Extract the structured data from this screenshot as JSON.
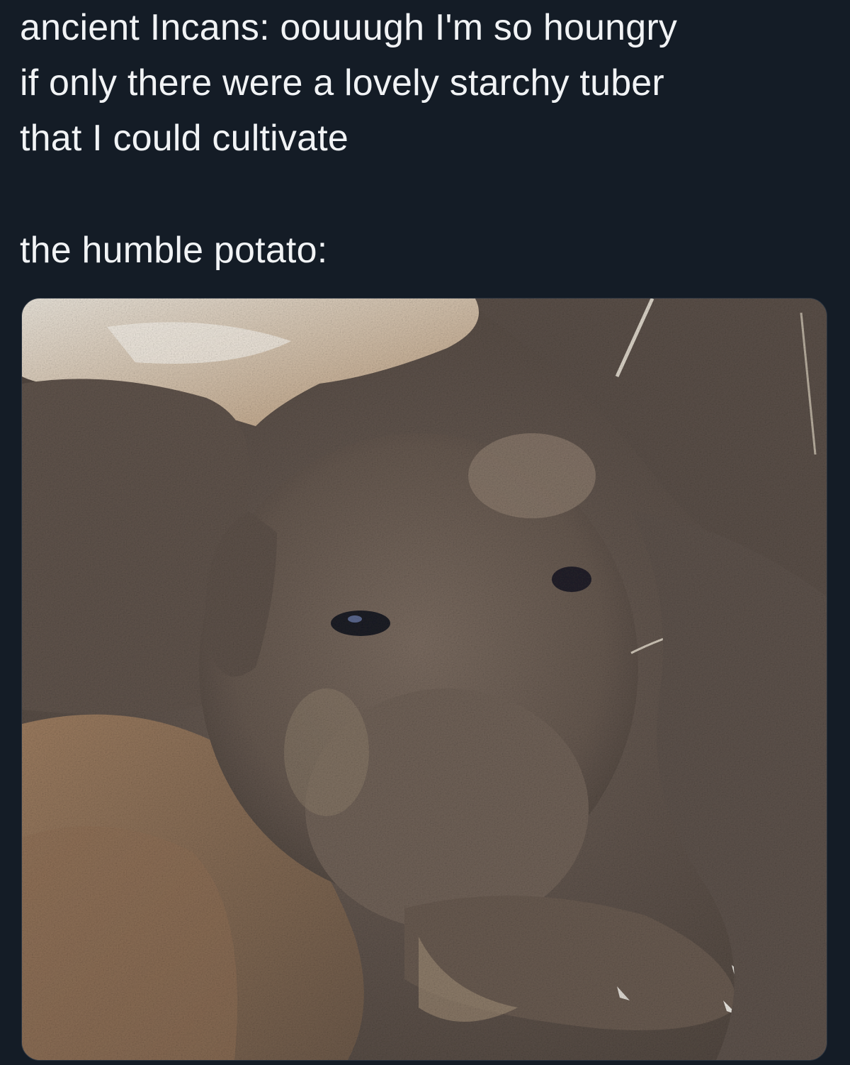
{
  "post": {
    "text_lines": [
      "ancient Incans: oouuugh I'm so houngry",
      "if only there were a lovely starchy tuber",
      "that I could cultivate",
      "the humble potato:"
    ]
  },
  "media": {
    "alt_subject": "puppy covered in dirt",
    "colors": {
      "background": "#141c26",
      "text": "#f1f3f5",
      "dirt": "#6a5c52",
      "fur": "#a8886a"
    }
  }
}
